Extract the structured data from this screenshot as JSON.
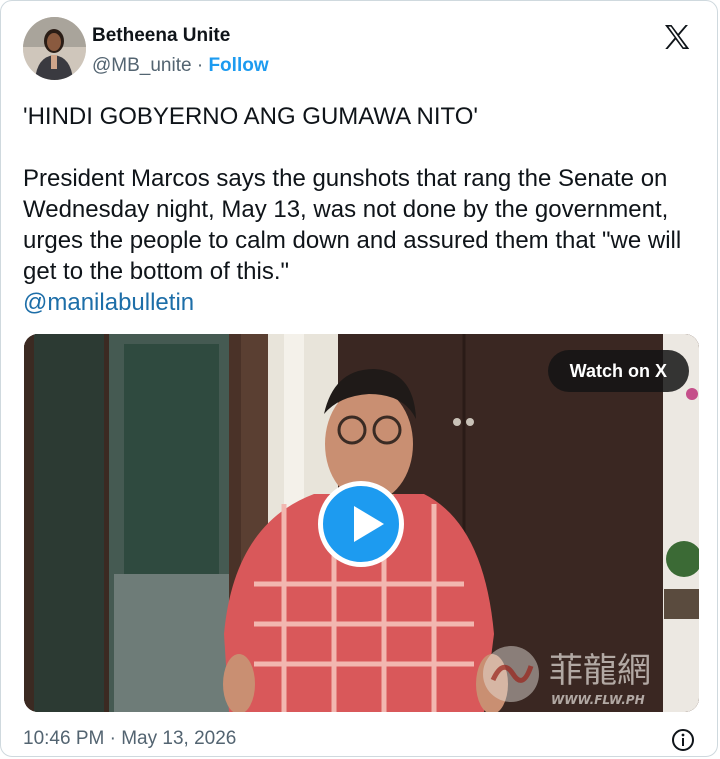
{
  "author": {
    "name": "Betheena Unite",
    "handle": "@MB_unite",
    "separator": "·",
    "follow_label": "Follow"
  },
  "icons": {
    "platform_logo": "x-logo-icon",
    "info": "info-icon",
    "play": "play-icon"
  },
  "tweet": {
    "headline": "'HINDI GOBYERNO ANG GUMAWA NITO'",
    "body": "President Marcos says the gunshots that rang the Senate on Wednesday night, May 13, was not done by the government, urges the people to calm down and assured them that \"we will get to the bottom of this.\"",
    "mention": "@manilabulletin"
  },
  "media": {
    "watch_label": "Watch on X",
    "watermark_text": "菲龍網",
    "watermark_url": "WWW.FLW.PH"
  },
  "footer": {
    "timestamp": "10:46 PM · May 13, 2026"
  },
  "colors": {
    "accent": "#1d9bf0",
    "mention": "#1d6ea8",
    "text": "#0f1419",
    "secondary": "#536471"
  }
}
